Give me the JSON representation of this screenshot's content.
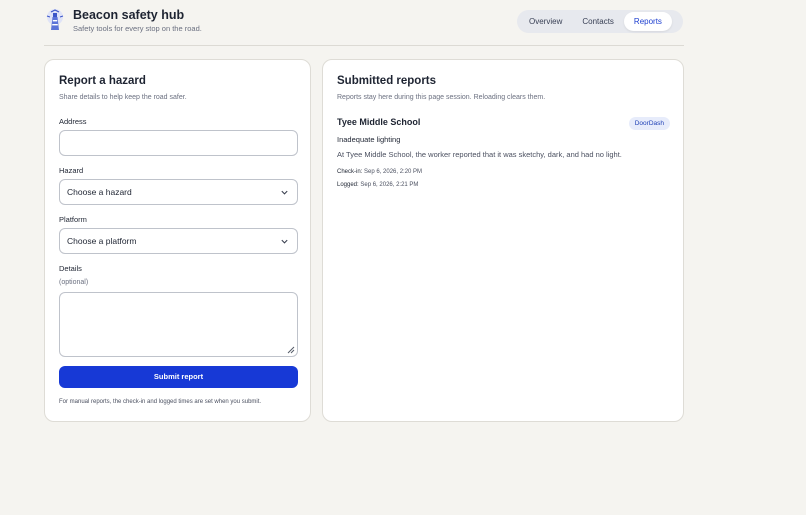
{
  "app": {
    "title": "Beacon safety hub",
    "subtitle": "Safety tools for every stop on the road."
  },
  "nav": {
    "tabs": [
      {
        "label": "Overview",
        "active": false
      },
      {
        "label": "Contacts",
        "active": false
      },
      {
        "label": "Reports",
        "active": true
      }
    ]
  },
  "report_form": {
    "title": "Report a hazard",
    "subtitle": "Share details to help keep the road safer.",
    "address": {
      "label": "Address",
      "value": "",
      "placeholder": ""
    },
    "hazard": {
      "label": "Hazard",
      "selected": "Choose a hazard"
    },
    "platform": {
      "label": "Platform",
      "selected": "Choose a platform"
    },
    "details": {
      "label": "Details",
      "hint": "(optional)",
      "value": ""
    },
    "submit_label": "Submit report",
    "footnote": "For manual reports, the check-in and logged times are set when you submit."
  },
  "submitted": {
    "title": "Submitted reports",
    "subtitle": "Reports stay here during this page session. Reloading clears them.",
    "reports": [
      {
        "location": "Tyee Middle School",
        "platform": "DoorDash",
        "hazard": "Inadequate lighting",
        "details": "At Tyee Middle School, the worker reported that it was sketchy, dark, and had no light.",
        "checkin_label": "Check-in:",
        "checkin_value": "Sep 6, 2026, 2:20 PM",
        "logged_label": "Logged:",
        "logged_value": "Sep 6, 2026, 2:21 PM"
      }
    ]
  },
  "colors": {
    "accent": "#1739d6",
    "background": "#f5f4f0",
    "badge_bg": "#e7ecfb"
  },
  "icons": {
    "logo": "beacon-lighthouse-logo",
    "select_chevron": "chevron-down-icon",
    "textarea_resize": "resize-handle-icon"
  }
}
